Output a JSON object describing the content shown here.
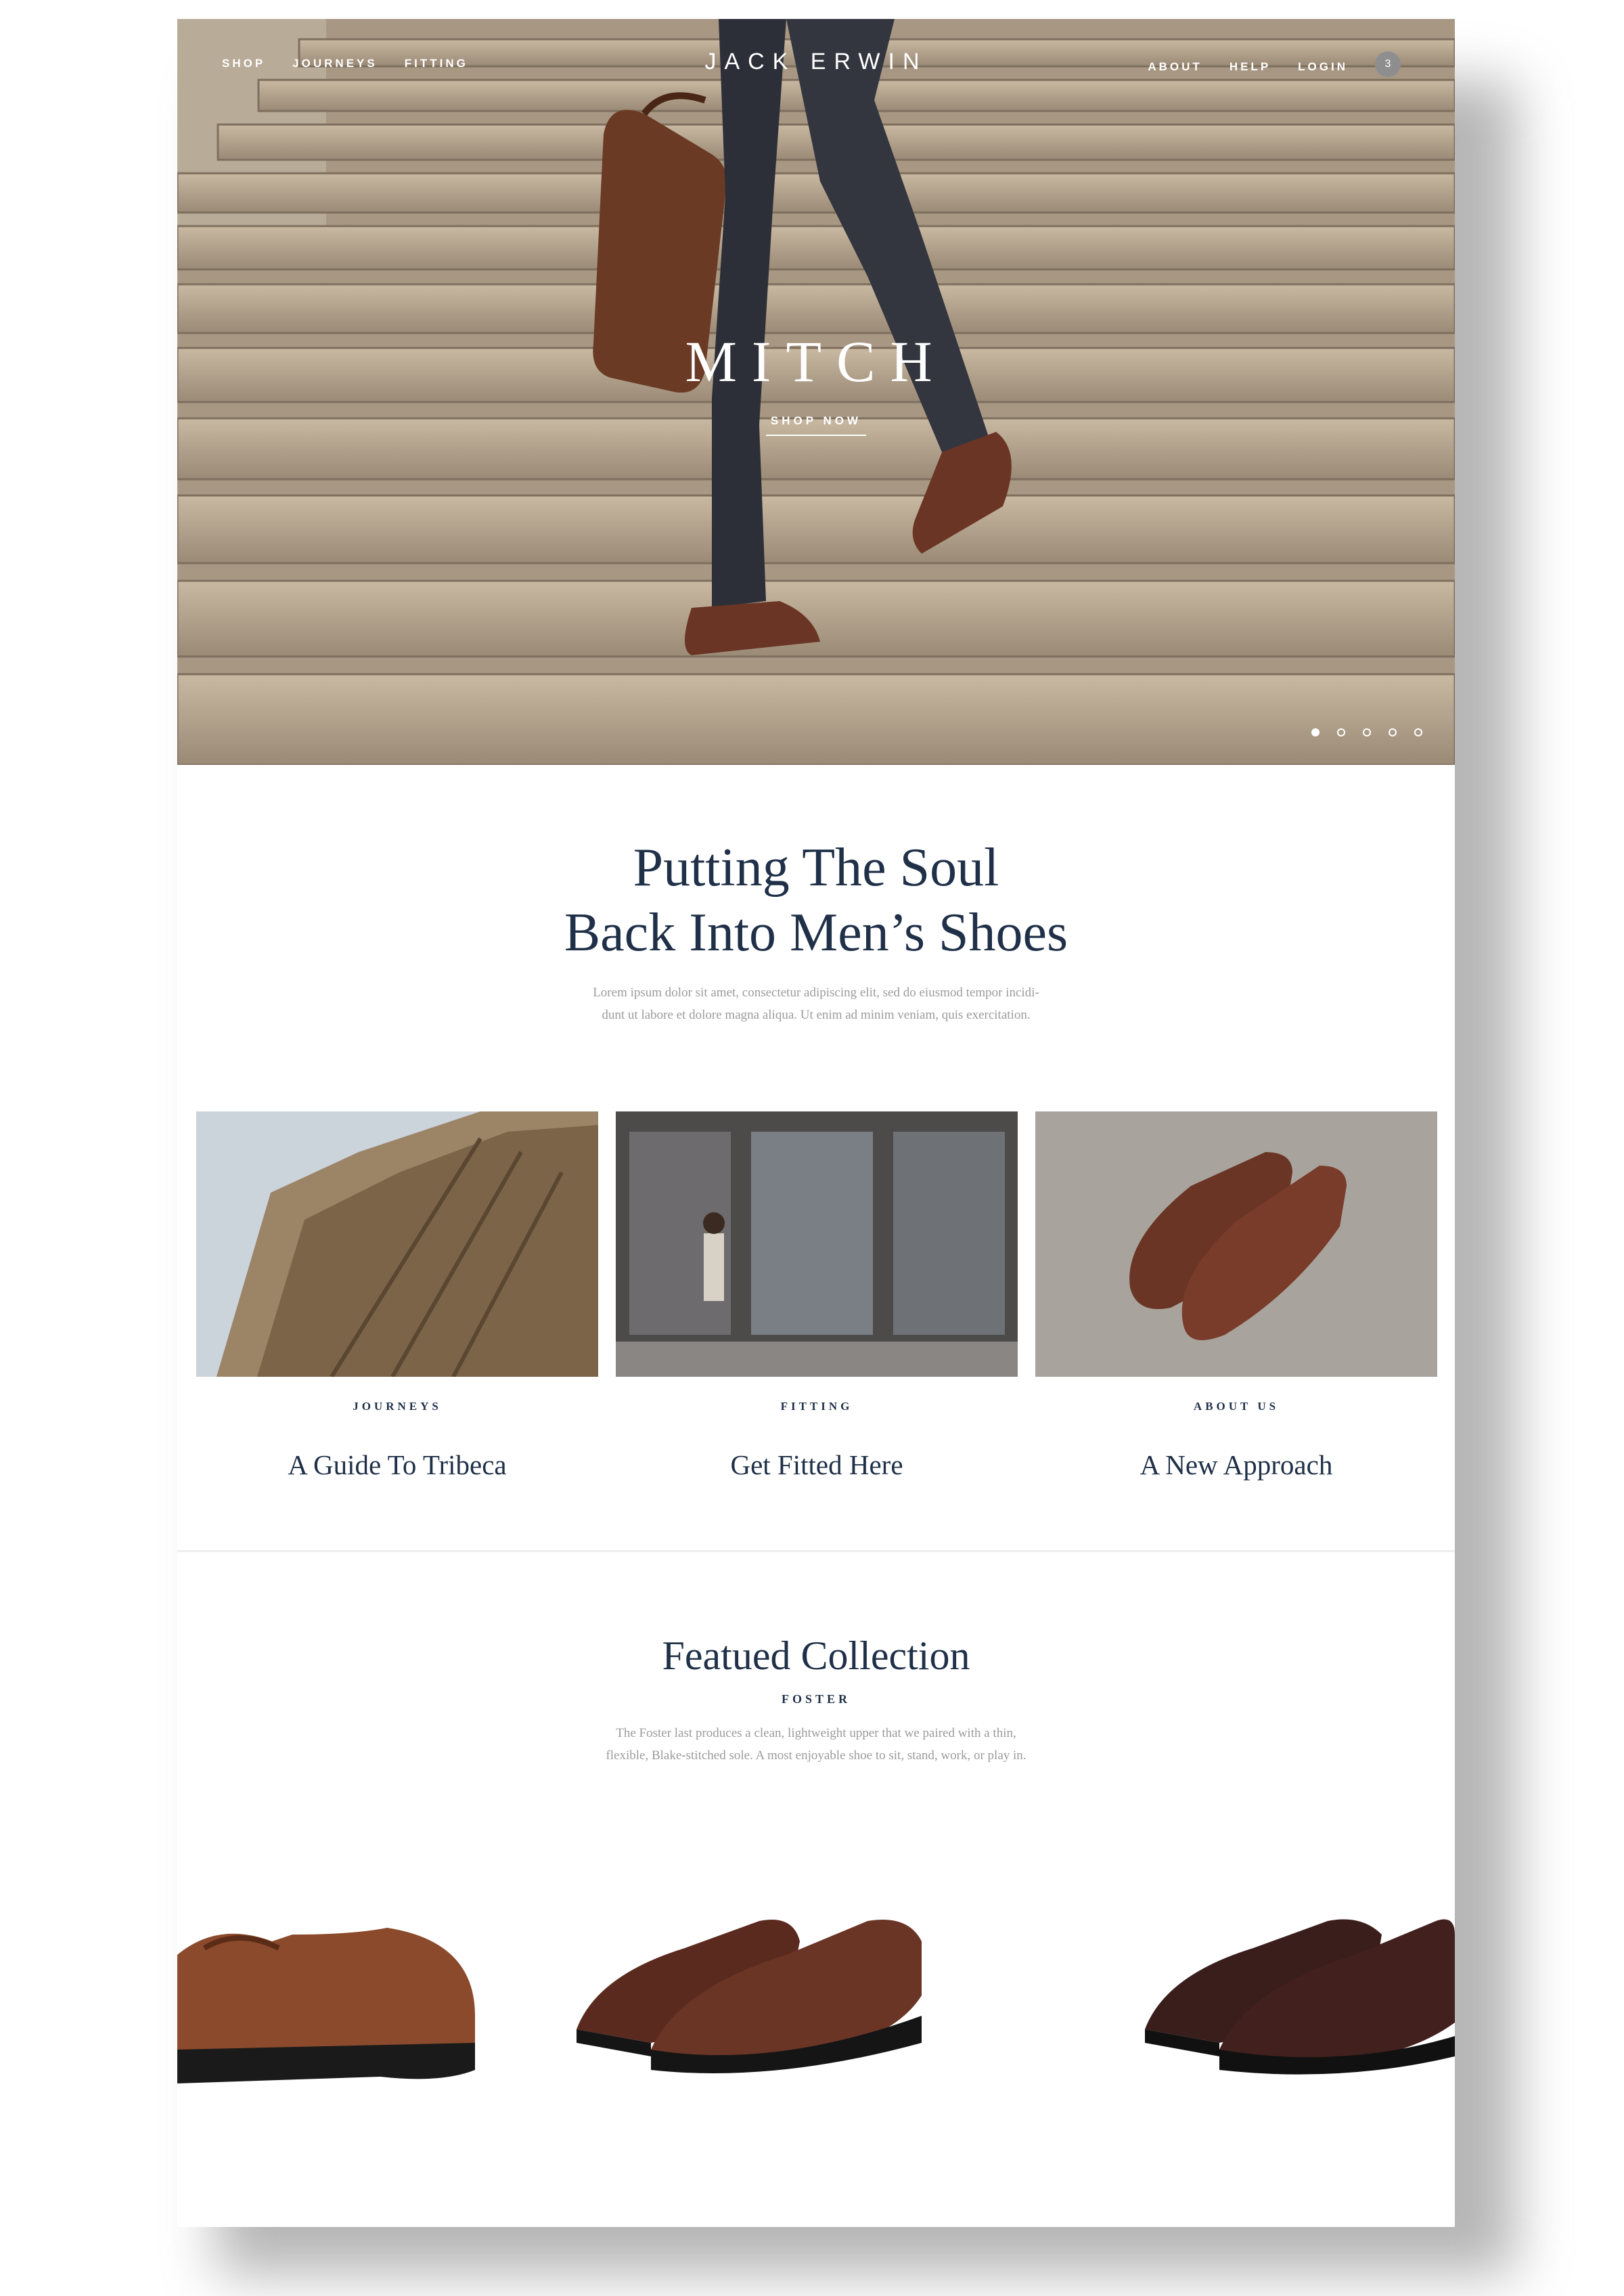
{
  "nav": {
    "left": [
      "SHOP",
      "JOURNEYS",
      "FITTING"
    ],
    "logo": "JACK ERWIN",
    "right": [
      "ABOUT",
      "HELP",
      "LOGIN"
    ],
    "cart_count": "3"
  },
  "hero": {
    "title": "MITCH",
    "cta": "SHOP NOW",
    "slides_total": 5,
    "active_slide": 1
  },
  "intro": {
    "headline_line1": "Putting The Soul",
    "headline_line2": "Back Into Men’s Shoes",
    "body_line1": "Lorem ipsum dolor sit amet, consectetur adipiscing elit, sed do eiusmod tempor incidi-",
    "body_line2": "dunt ut labore et dolore magna aliqua. Ut enim ad minim veniam, quis exercitation."
  },
  "cards": [
    {
      "kicker": "JOURNEYS",
      "title": "A Guide To Tribeca"
    },
    {
      "kicker": "FITTING",
      "title": "Get Fitted Here"
    },
    {
      "kicker": "ABOUT US",
      "title": "A New Approach"
    }
  ],
  "featured": {
    "title": "Featued Collection",
    "subtitle": "FOSTER",
    "desc_line1": "The Foster last produces a clean, lightweight upper that we paired with a thin,",
    "desc_line2": "flexible, Blake-stitched sole. A most enjoyable shoe to sit, stand, work, or play in."
  },
  "colors": {
    "navy": "#1f3048",
    "body_gray": "#9b9b9b",
    "leather_brown": "#6b3526"
  }
}
